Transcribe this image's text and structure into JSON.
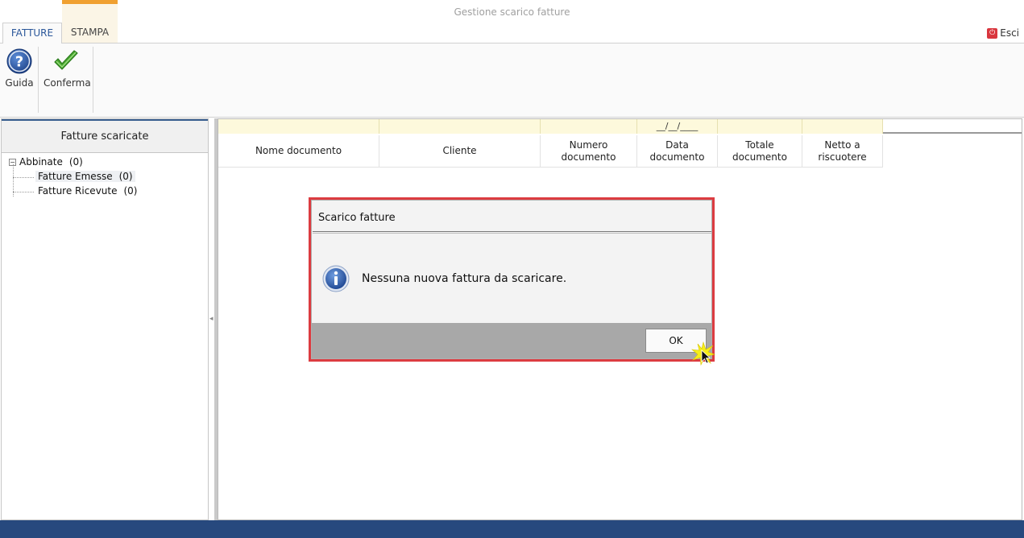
{
  "window": {
    "title": "Gestione scarico fatture"
  },
  "ribbon": {
    "tabs": [
      {
        "label": "FATTURE",
        "active": true
      },
      {
        "label": "STAMPA",
        "active": false
      }
    ],
    "exit_label": "Esci",
    "buttons": {
      "guida": {
        "label": "Guida",
        "icon": "help-icon"
      },
      "conferma": {
        "label": "Conferma",
        "icon": "checkmark-icon"
      }
    }
  },
  "left_panel": {
    "title": "Fatture scaricate",
    "tree": {
      "root": {
        "label": "Abbinate",
        "count": "(0)",
        "expander": "−"
      },
      "children": [
        {
          "label": "Fatture Emesse",
          "count": "(0)"
        },
        {
          "label": "Fatture Ricevute",
          "count": "(0)"
        }
      ]
    }
  },
  "grid": {
    "filter_row": [
      "",
      "",
      "",
      "__/__/____",
      "",
      ""
    ],
    "columns": [
      "Nome documento",
      "Cliente",
      "Numero documento",
      "Data documento",
      "Totale documento",
      "Netto a riscuotere"
    ]
  },
  "dialog": {
    "title": "Scarico fatture",
    "message": "Nessuna nuova fattura da scaricare.",
    "ok_label": "OK",
    "icon": "info-icon"
  },
  "colors": {
    "accent": "#2b579a",
    "contextual_tab": "#f0a030",
    "dialog_border": "#dc3c41",
    "statusbar": "#27497e",
    "filter_bg": "#fdf9dc"
  }
}
